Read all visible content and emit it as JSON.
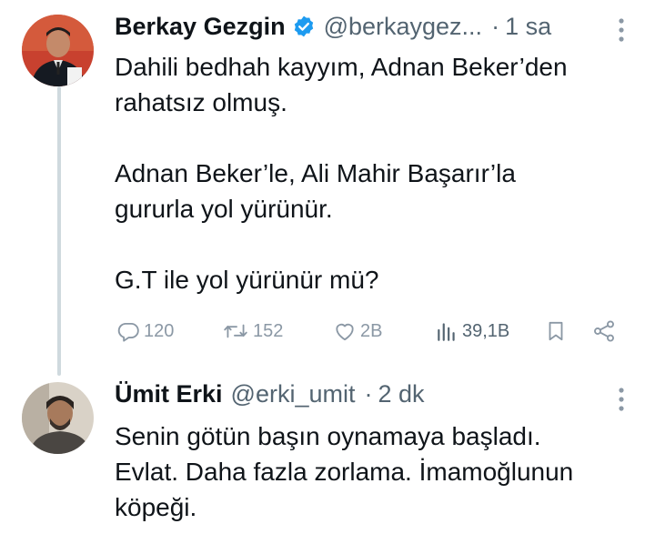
{
  "tweets": [
    {
      "name": "Berkay Gezgin",
      "handle": "@berkaygez...",
      "separator": "·",
      "time": "1 sa",
      "lines": [
        "Dahili bedhah kayyım, Adnan Beker’den",
        "rahatsız olmuş.",
        "",
        "Adnan Beker’le, Ali Mahir Başarır’la",
        "gururla yol yürünür.",
        "",
        "G.T ile yol yürünür mü?"
      ],
      "stats": {
        "replies": "120",
        "retweets": "152",
        "likes": "2B",
        "views": "39,1B"
      },
      "verified": true,
      "verified_color": "#1d9bf0"
    },
    {
      "name": "Ümit Erki",
      "handle": "@erki_umit",
      "separator": "·",
      "time": "2 dk",
      "lines": [
        "Senin götün başın oynamaya başladı.",
        "Evlat. Daha fazla zorlama. İmamoğlunun",
        "köpeği."
      ]
    }
  ],
  "icons": {
    "more": "more-vertical-icon",
    "reply": "reply-icon",
    "retweet": "retweet-icon",
    "like": "heart-icon",
    "views": "views-icon",
    "bookmark": "bookmark-icon",
    "share": "share-icon"
  },
  "colors": {
    "text": "#0f1419",
    "secondary": "#536471",
    "muted": "#8b98a5",
    "thread_line": "#cfd9de"
  }
}
